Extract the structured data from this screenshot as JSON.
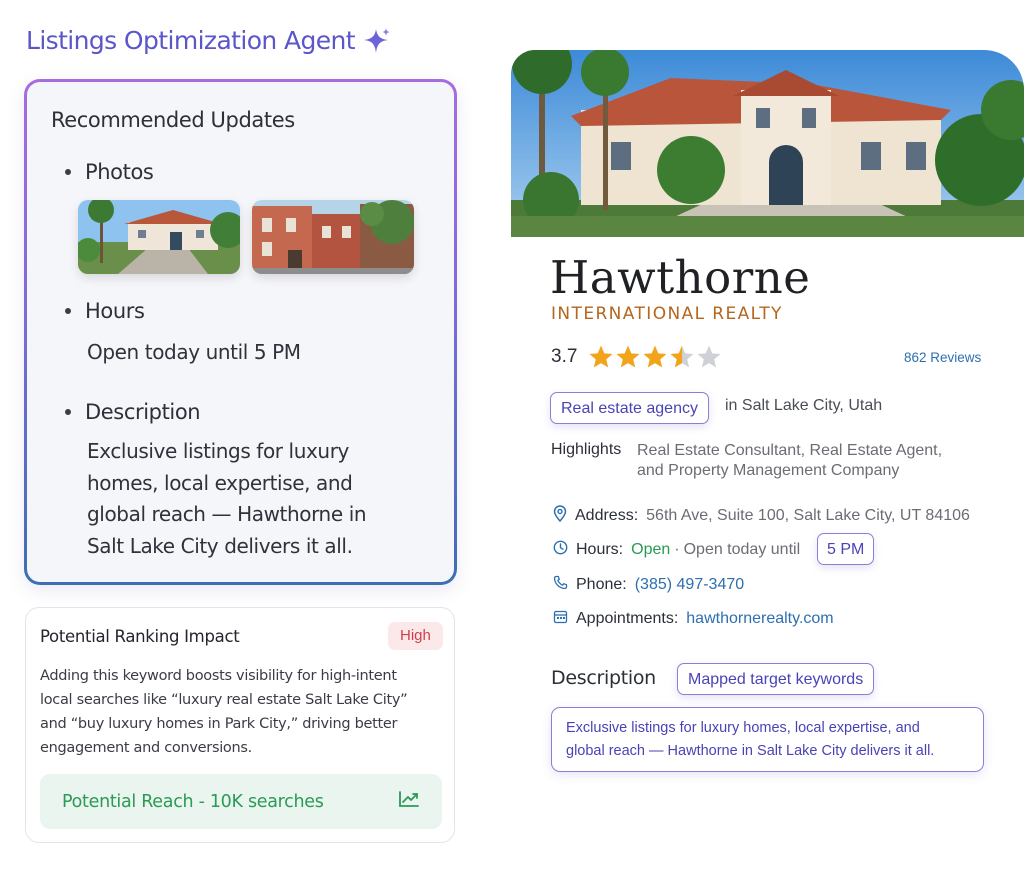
{
  "agent": {
    "title": "Listings Optimization Agent",
    "icon": "sparkle-icon",
    "accent_color": "#5b56c9"
  },
  "updates": {
    "heading": "Recommended Updates",
    "photos_label": "Photos",
    "hours_label": "Hours",
    "hours_value": "Open today until 5 PM",
    "description_label": "Description",
    "description_lines": [
      "Exclusive listings for luxury",
      "homes, local expertise, and",
      "global reach — Hawthorne in",
      "Salt Lake City delivers it all."
    ]
  },
  "impact": {
    "title": "Potential Ranking Impact",
    "badge": "High",
    "body_lines": [
      "Adding this keyword boosts visibility for high-intent",
      "local searches like “luxury real estate Salt Lake City”",
      "and “buy luxury homes in Park City,” driving better",
      "engagement and conversions."
    ],
    "reach": "Potential Reach - 10K searches",
    "reach_icon": "trend-up-icon",
    "badge_color": "#d0404a",
    "reach_color": "#2a9a55"
  },
  "listing": {
    "name": "Hawthorne",
    "subtitle": "INTERNATIONAL REALTY",
    "rating": "3.7",
    "rating_value": 3.7,
    "rating_max": 5,
    "reviews": "862 Reviews",
    "category": "Real estate agency",
    "location": "in Salt Lake City, Utah",
    "highlights_label": "Highlights",
    "highlights_lines": [
      "Real Estate Consultant, Real Estate Agent,",
      "and Property Management Company"
    ],
    "address_label": "Address:",
    "address": "56th Ave, Suite 100, Salt Lake City, UT 84106",
    "hours_label": "Hours:",
    "hours_status": "Open",
    "hours_sep": "·",
    "hours_text": "Open today until",
    "hours_time": "5 PM",
    "phone_label": "Phone:",
    "phone": "(385) 497-3470",
    "appointments_label": "Appointments:",
    "appointments": "hawthornerealty.com",
    "description_label": "Description",
    "keywords_chip": "Mapped target keywords",
    "description_lines": [
      "Exclusive listings for luxury homes, local expertise, and",
      "global reach — Hawthorne in Salt Lake City delivers it all."
    ],
    "brand_color": "#b5651d",
    "link_color": "#2d6fb0",
    "star_color": "#f2a51a"
  }
}
